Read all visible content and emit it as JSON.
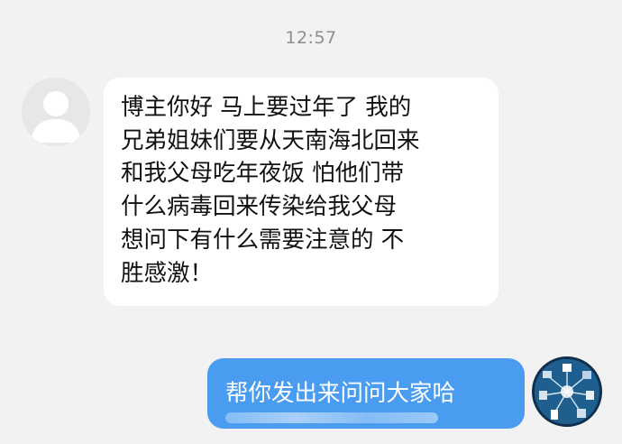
{
  "status": {
    "time": "12:57"
  },
  "messages": [
    {
      "direction": "incoming",
      "avatar_icon": "default-user-icon",
      "text": "博主你好 马上要过年了 我的\n兄弟姐妹们要从天南海北回来\n和我父母吃年夜饭 怕他们带\n什么病毒回来传染给我父母\n想问下有什么需要注意的 不\n胜感激！"
    },
    {
      "direction": "outgoing",
      "avatar_icon": "user-avatar-image",
      "text": "帮你发出来问问大家哈"
    }
  ],
  "colors": {
    "background": "#f2f2f2",
    "incoming_bubble": "#ffffff",
    "outgoing_bubble": "#4a9cf0",
    "timestamp_text": "#8e8e8e"
  }
}
